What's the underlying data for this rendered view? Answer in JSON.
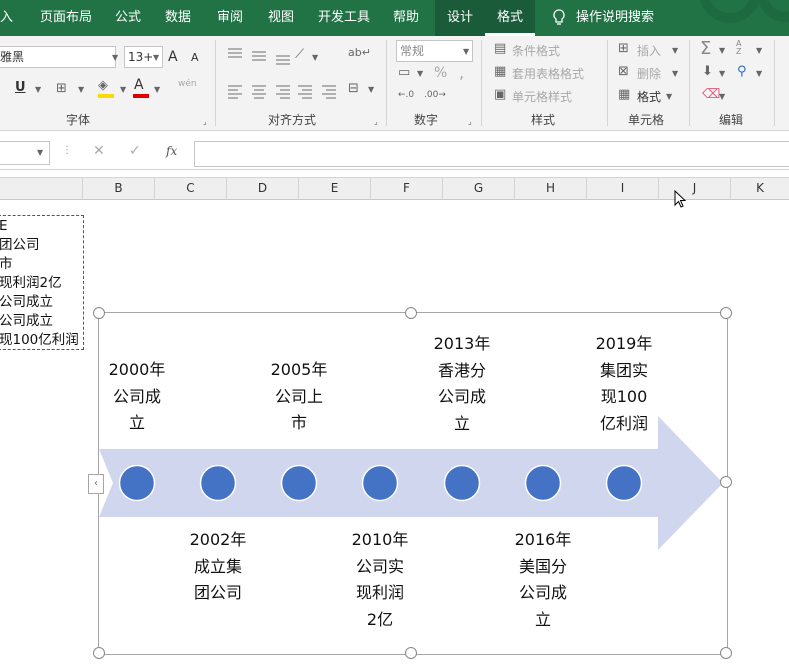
{
  "ribbon_tabs": [
    "入",
    "页面布局",
    "公式",
    "数据",
    "审阅",
    "视图",
    "开发工具",
    "帮助",
    "设计",
    "格式"
  ],
  "tell_me": "操作说明搜索",
  "font": {
    "name": "雅黑",
    "size": "13+",
    "grow": "A",
    "shrink": "A"
  },
  "groups": {
    "font": "字体",
    "align": "对齐方式",
    "number": "数字",
    "styles": "样式",
    "cells": "单元格",
    "editing": "编辑"
  },
  "number_format": "常规",
  "styles_items": [
    "条件格式",
    "套用表格格式",
    "单元格样式"
  ],
  "cells_items": [
    "插入",
    "删除",
    "格式"
  ],
  "misc": {
    "underline": "U",
    "font_color": "A",
    "phonetic": "wén",
    "percent": "%",
    "comma": ",",
    "fx": "fx",
    "sort": "A Z"
  },
  "columns": [
    "B",
    "C",
    "D",
    "E",
    "F",
    "G",
    "H",
    "I",
    "J",
    "K"
  ],
  "cell_lines": [
    "E",
    "团公司",
    "市",
    "现利润2亿",
    "公司成立",
    "公司成立",
    "现100亿利润"
  ],
  "timeline": {
    "top_labels": [
      "2000年\n公司成\n立",
      "2005年\n公司上\n市",
      "2013年\n香港分\n公司成\n立",
      "2019年\n集团实\n现100\n亿利润"
    ],
    "bottom_labels": [
      "2002年\n成立集\n团公司",
      "2010年\n公司实\n现利润\n2亿",
      "2016年\n美国分\n公司成\n立"
    ],
    "colors": {
      "arrow": "#d0d6ee",
      "dot": "#4472c4"
    }
  }
}
